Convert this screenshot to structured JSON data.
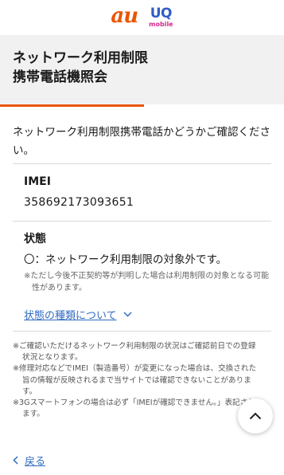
{
  "header": {
    "au_logo": "au",
    "uq_logo_top": "UQ",
    "uq_logo_bottom": "mobile"
  },
  "page_title": "ネットワーク利用制限\n携帯電話機照会",
  "intro": "ネットワーク利用制限携帯電話かどうかご確認ください。",
  "imei": {
    "label": "IMEI",
    "value": "358692173093651"
  },
  "status": {
    "label": "状態",
    "text": "〇：ネットワーク利用制限の対象外です。",
    "note": "※ただし今後不正契約等が判明した場合は利用制限の対象となる可能性があります。",
    "link": "状態の種類について"
  },
  "notes": [
    "※ご確認いただけるネットワーク利用制限の状況はご確認前日での登録状況となります。",
    "※修理対応などでIMEI（製造番号）が変更になった場合は、交換された旨の情報が反映されるまで当サイトでは確認できないことがあります。",
    "※3Gスマートフォンの場合は必ず「IMEIが確認できません。」表記されます。"
  ],
  "back_link": "戻る",
  "colors": {
    "accent": "#eb5505",
    "link": "#2f6ac2",
    "uq_blue": "#2f5cc7",
    "uq_pink": "#d42a8c"
  },
  "icons": [
    "chevron-down-icon",
    "chevron-left-icon",
    "chevron-up-icon"
  ]
}
